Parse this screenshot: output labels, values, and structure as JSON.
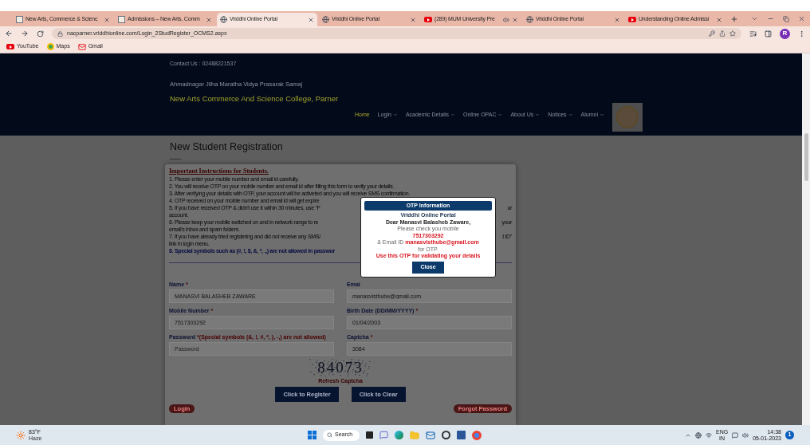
{
  "browser": {
    "tabs": [
      {
        "title": "New Arts, Commerce & Scienc",
        "kind": "college",
        "selected": false,
        "audio": false
      },
      {
        "title": "Admissions – New Arts, Comm",
        "kind": "college",
        "selected": false,
        "audio": false
      },
      {
        "title": "Vriddhi Online Portal",
        "kind": "globe",
        "selected": true,
        "audio": false
      },
      {
        "title": "Vriddhi Online Portal",
        "kind": "globe",
        "selected": false,
        "audio": false
      },
      {
        "title": "(289) MUM University Pre",
        "kind": "youtube",
        "selected": false,
        "audio": true
      },
      {
        "title": "Vriddhi Online Portal",
        "kind": "globe",
        "selected": false,
        "audio": false
      },
      {
        "title": "Understanding Online Admissi",
        "kind": "youtube",
        "selected": false,
        "audio": false
      }
    ],
    "url": "nacparner.vriddhionline.com/Login_2StudRegister_OCMS2.aspx",
    "profile": "R",
    "bookmarks": [
      {
        "label": "YouTube",
        "kind": "youtube"
      },
      {
        "label": "Maps",
        "kind": "maps"
      },
      {
        "label": "Gmail",
        "kind": "gmail"
      }
    ]
  },
  "site": {
    "contact": "Contact Us : 02488221537",
    "society": "Ahmadnagar Jilha Maratha Vidya Prasarak Samaj",
    "college": "New Arts Commerce And Science College, Parner",
    "nav": [
      {
        "label": "Home",
        "selected": true,
        "dropdown": false
      },
      {
        "label": "Login",
        "selected": false,
        "dropdown": true
      },
      {
        "label": "Academic Details",
        "selected": false,
        "dropdown": true
      },
      {
        "label": "Online OPAC",
        "selected": false,
        "dropdown": true
      },
      {
        "label": "About Us",
        "selected": false,
        "dropdown": true
      },
      {
        "label": "Notices",
        "selected": false,
        "dropdown": true
      },
      {
        "label": "Alumni",
        "selected": false,
        "dropdown": true
      }
    ]
  },
  "page": {
    "title": "New Student Registration",
    "instructions": {
      "heading": "Important Instructions for Students.",
      "lines": [
        {
          "kind": "normal",
          "text": "1. Please enter your mobile number and email id carefully."
        },
        {
          "kind": "normal",
          "text": "2. You will receive OTP on your mobile number and email id after filling this form to verify your details."
        },
        {
          "kind": "normal",
          "text": "3. After verifying your details with OTP, your account will be activeted and you will receive SMS confirmation."
        },
        {
          "kind": "normal",
          "text": "4. OTP received on your mobile number and email id will get expire"
        },
        {
          "kind": "normal",
          "text": "5. If you have received OTP & didn't use it within 30 minutes, use \"F",
          "end": "ur"
        },
        {
          "kind": "normal",
          "text": "account."
        },
        {
          "kind": "normal",
          "text": "6. Please keep your mobile switched on and in network range to re",
          "end": "your"
        },
        {
          "kind": "normal",
          "text": "email's inbox and spam folders."
        },
        {
          "kind": "normal",
          "text": "7. If you have already tried registering and did not receive any SMS/",
          "end": "t ID\""
        },
        {
          "kind": "normal",
          "text": "link in login menu."
        },
        {
          "kind": "note",
          "text": "8. Special symbols such as (#, !, $, &, *, .,) are not allowed in passwor"
        }
      ]
    },
    "fields": [
      {
        "label": "Name",
        "mark": "*",
        "value": "MANASVI BALASHEB ZAWARE"
      },
      {
        "label": "Emai",
        "value": "manasvisthube@gmail.com"
      },
      {
        "label": "Mobile Number",
        "mark": "*",
        "value": "7517303292"
      },
      {
        "label": "Birth Date (DD/MM/YYYY)",
        "mark": "*",
        "value": "01/04/2003"
      },
      {
        "label": "Password",
        "note": "*(Special symbols (&, !, #, *, ), -,) are not allowed)",
        "placeholder": "Password"
      },
      {
        "label": "Captcha",
        "mark": "*",
        "value": "3084"
      }
    ],
    "captcha": "84073",
    "refresh": "Refresh Captcha",
    "buttons": [
      "Click to Register",
      "Click to Clear"
    ],
    "login": "Login",
    "forgot": "Forgot Password"
  },
  "modal": {
    "title": "OTP Information",
    "portal": "Vriddhi Online Portal",
    "greeting": "Dear Manasvi Balasheb Zaware,",
    "check": "Please check you mobile",
    "mobile": "7517303292",
    "email_label": "& Email ID",
    "email": "manasvisthube@gmail.com",
    "for": "for OTP.",
    "use": "Use this OTP for validating your details",
    "close": "Close"
  },
  "taskbar": {
    "temperature": "83°F",
    "weather": "Haze",
    "search": "Search",
    "lang": "ENG",
    "region": "IN",
    "time": "14:38",
    "date": "05-01-2023",
    "badge": "1"
  }
}
